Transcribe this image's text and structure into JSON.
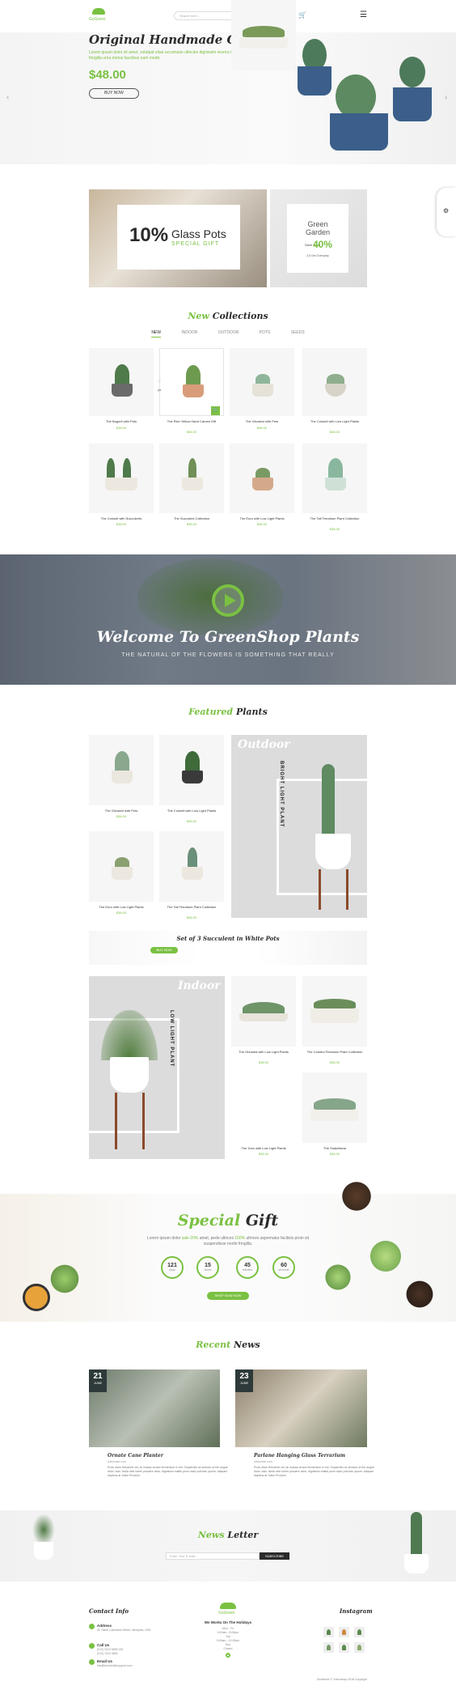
{
  "header": {
    "logo_text": "GoGreen",
    "search_placeholder": "Search here...",
    "icons": [
      "search-icon",
      "heart-icon",
      "cart-icon",
      "menu-icon"
    ]
  },
  "hero": {
    "title": "Original Handmade Ceramic",
    "desc": "Lorem ipsum dolor sit amet, volutpat vitae accumsan ultricies dignissim viverra in fringilla urna metus faucibus nam morbi.",
    "price": "$48.00",
    "button": "BUY NOW"
  },
  "promo": {
    "percent": "10%",
    "title": "Glass Pots",
    "subtitle": "SPECIAL GIFT",
    "garden_line1": "Green",
    "garden_line2": "Garden",
    "save_label": "Save up to",
    "save_percent": "40%",
    "date_text": "3-5 Dec Everyday"
  },
  "collections": {
    "title_accent": "New",
    "title_rest": "Collections",
    "tabs": [
      "NEW",
      "INDOOR",
      "OUTDOOR",
      "POTS",
      "SEEDS"
    ],
    "products": [
      {
        "name": "The Bogorit with Pots",
        "price": "$38.00"
      },
      {
        "name": "The Rich Yellow Hand Carved Gift",
        "price": "$38.00"
      },
      {
        "name": "The Ghosted with Pots",
        "price": "$38.00"
      },
      {
        "name": "The Colosrit with Low Light Plants",
        "price": "$38.00"
      },
      {
        "name": "The Colosrit with Succulents",
        "price": "$38.00"
      },
      {
        "name": "The Succulent Collection",
        "price": "$38.00"
      },
      {
        "name": "The Euro with Low Light Plants",
        "price": "$38.00"
      },
      {
        "name": "The Tall Terrarium Plant Collection",
        "price": "$38.00"
      }
    ]
  },
  "welcome": {
    "title": "Welcome To GreenShop Plants",
    "subtitle": "THE NATURAL OF THE FLOWERS IS SOMETHING THAT REALLY"
  },
  "featured": {
    "title_accent": "Featured",
    "title_rest": "Plants",
    "outdoor_label": "Outdoor",
    "outdoor_vertical": "BRIGHT LIGHT PLANT",
    "indoor_label": "Indoor",
    "indoor_vertical": "LOW LIGHT PLANT",
    "products_top": [
      {
        "name": "The Ghosted with Pots",
        "price": "$38.00"
      },
      {
        "name": "The Colosrit with Low Light Plants",
        "price": "$38.00"
      },
      {
        "name": "The Euro with Low Light Plants",
        "price": "$38.00"
      },
      {
        "name": "The Tall Terrarium Plant Collection",
        "price": "$38.00"
      }
    ],
    "products_bottom": [
      {
        "name": "The Ghosted with Low Light Plants",
        "price": "$38.00"
      },
      {
        "name": "The Colorful Terrarium Plant Collection",
        "price": "$38.00"
      },
      {
        "name": "The Juno with Low Light Plants",
        "price": "$38.00"
      },
      {
        "name": "The Snakeliana",
        "price": "$38.00"
      }
    ],
    "banner_title": "Set of 3 Succulent in White Pots",
    "banner_button": "BUY NOW"
  },
  "gift": {
    "title_accent": "Special",
    "title_rest": "Gift",
    "desc_pre": "Lorem ipsum dolor ",
    "desc_hl1": "sale 20% ",
    "desc_mid": "amet, pede ultrices ",
    "desc_hl2": "150% ",
    "desc_post": "ultrices aspernatur facilisis proin sit suspendisse morbi fringilla.",
    "timers": [
      {
        "value": "121",
        "unit": "days"
      },
      {
        "value": "15",
        "unit": "hours"
      },
      {
        "value": "45",
        "unit": "minutes"
      },
      {
        "value": "60",
        "unit": "seconds"
      }
    ],
    "button": "SHOP NOW NOW"
  },
  "news": {
    "title_accent": "Recent",
    "title_rest": "News",
    "posts": [
      {
        "day": "21",
        "month": "JUNE",
        "title": "Ornate Cane Planter",
        "meta": "Adminsite.com",
        "text": "Proin diam Hendrerit vel, ac massa ornare fermentum in est. Suspendis se session of the augue dolor, duis. Nulla vide lorem posuere dolor, dignissim mattis proin dolor pulvinar, ipsum. Aliquam dapibus at Julice Proctive."
      },
      {
        "day": "23",
        "month": "JUNE",
        "title": "Parlane Hanging Glass Terrarium",
        "meta": "Adminsite.com",
        "text": "Proin diam Hendrerit vel, ac massa ornare fermentum in est. Suspendis se session of the augue dolor, duis. Nulla vide lorem posuere dolor, dignissim mattis proin dolor pulvinar, ipsum. Aliquam dapibus at Julice Proctive."
      }
    ]
  },
  "newsletter": {
    "title_accent": "News",
    "title_rest": "Letter",
    "placeholder": "Enter Your E-mail...",
    "button": "SUBSCRIBE"
  },
  "footer": {
    "contact_title": "Contact Info",
    "address_label": "Address",
    "address_value": "5C Sleek Cleveland Street, Memphis, USA",
    "call_label": "Call Us",
    "call_value": "(012) 0222 5659 251\n(012) 1313 4662",
    "email_label": "Email Us",
    "email_value": "info@domain@support.com",
    "logo_text": "GoGreen",
    "hours_title": "We Works On The Holidays",
    "hours_lines": [
      "Mon - Fri",
      "9:00am - 8:00pm",
      "Sat",
      "9:00am - 12:00pm",
      "Sun",
      "Closed"
    ],
    "instagram_title": "Instagram",
    "copyright": "Zentheme © Greenshop 2018 Copyright"
  }
}
